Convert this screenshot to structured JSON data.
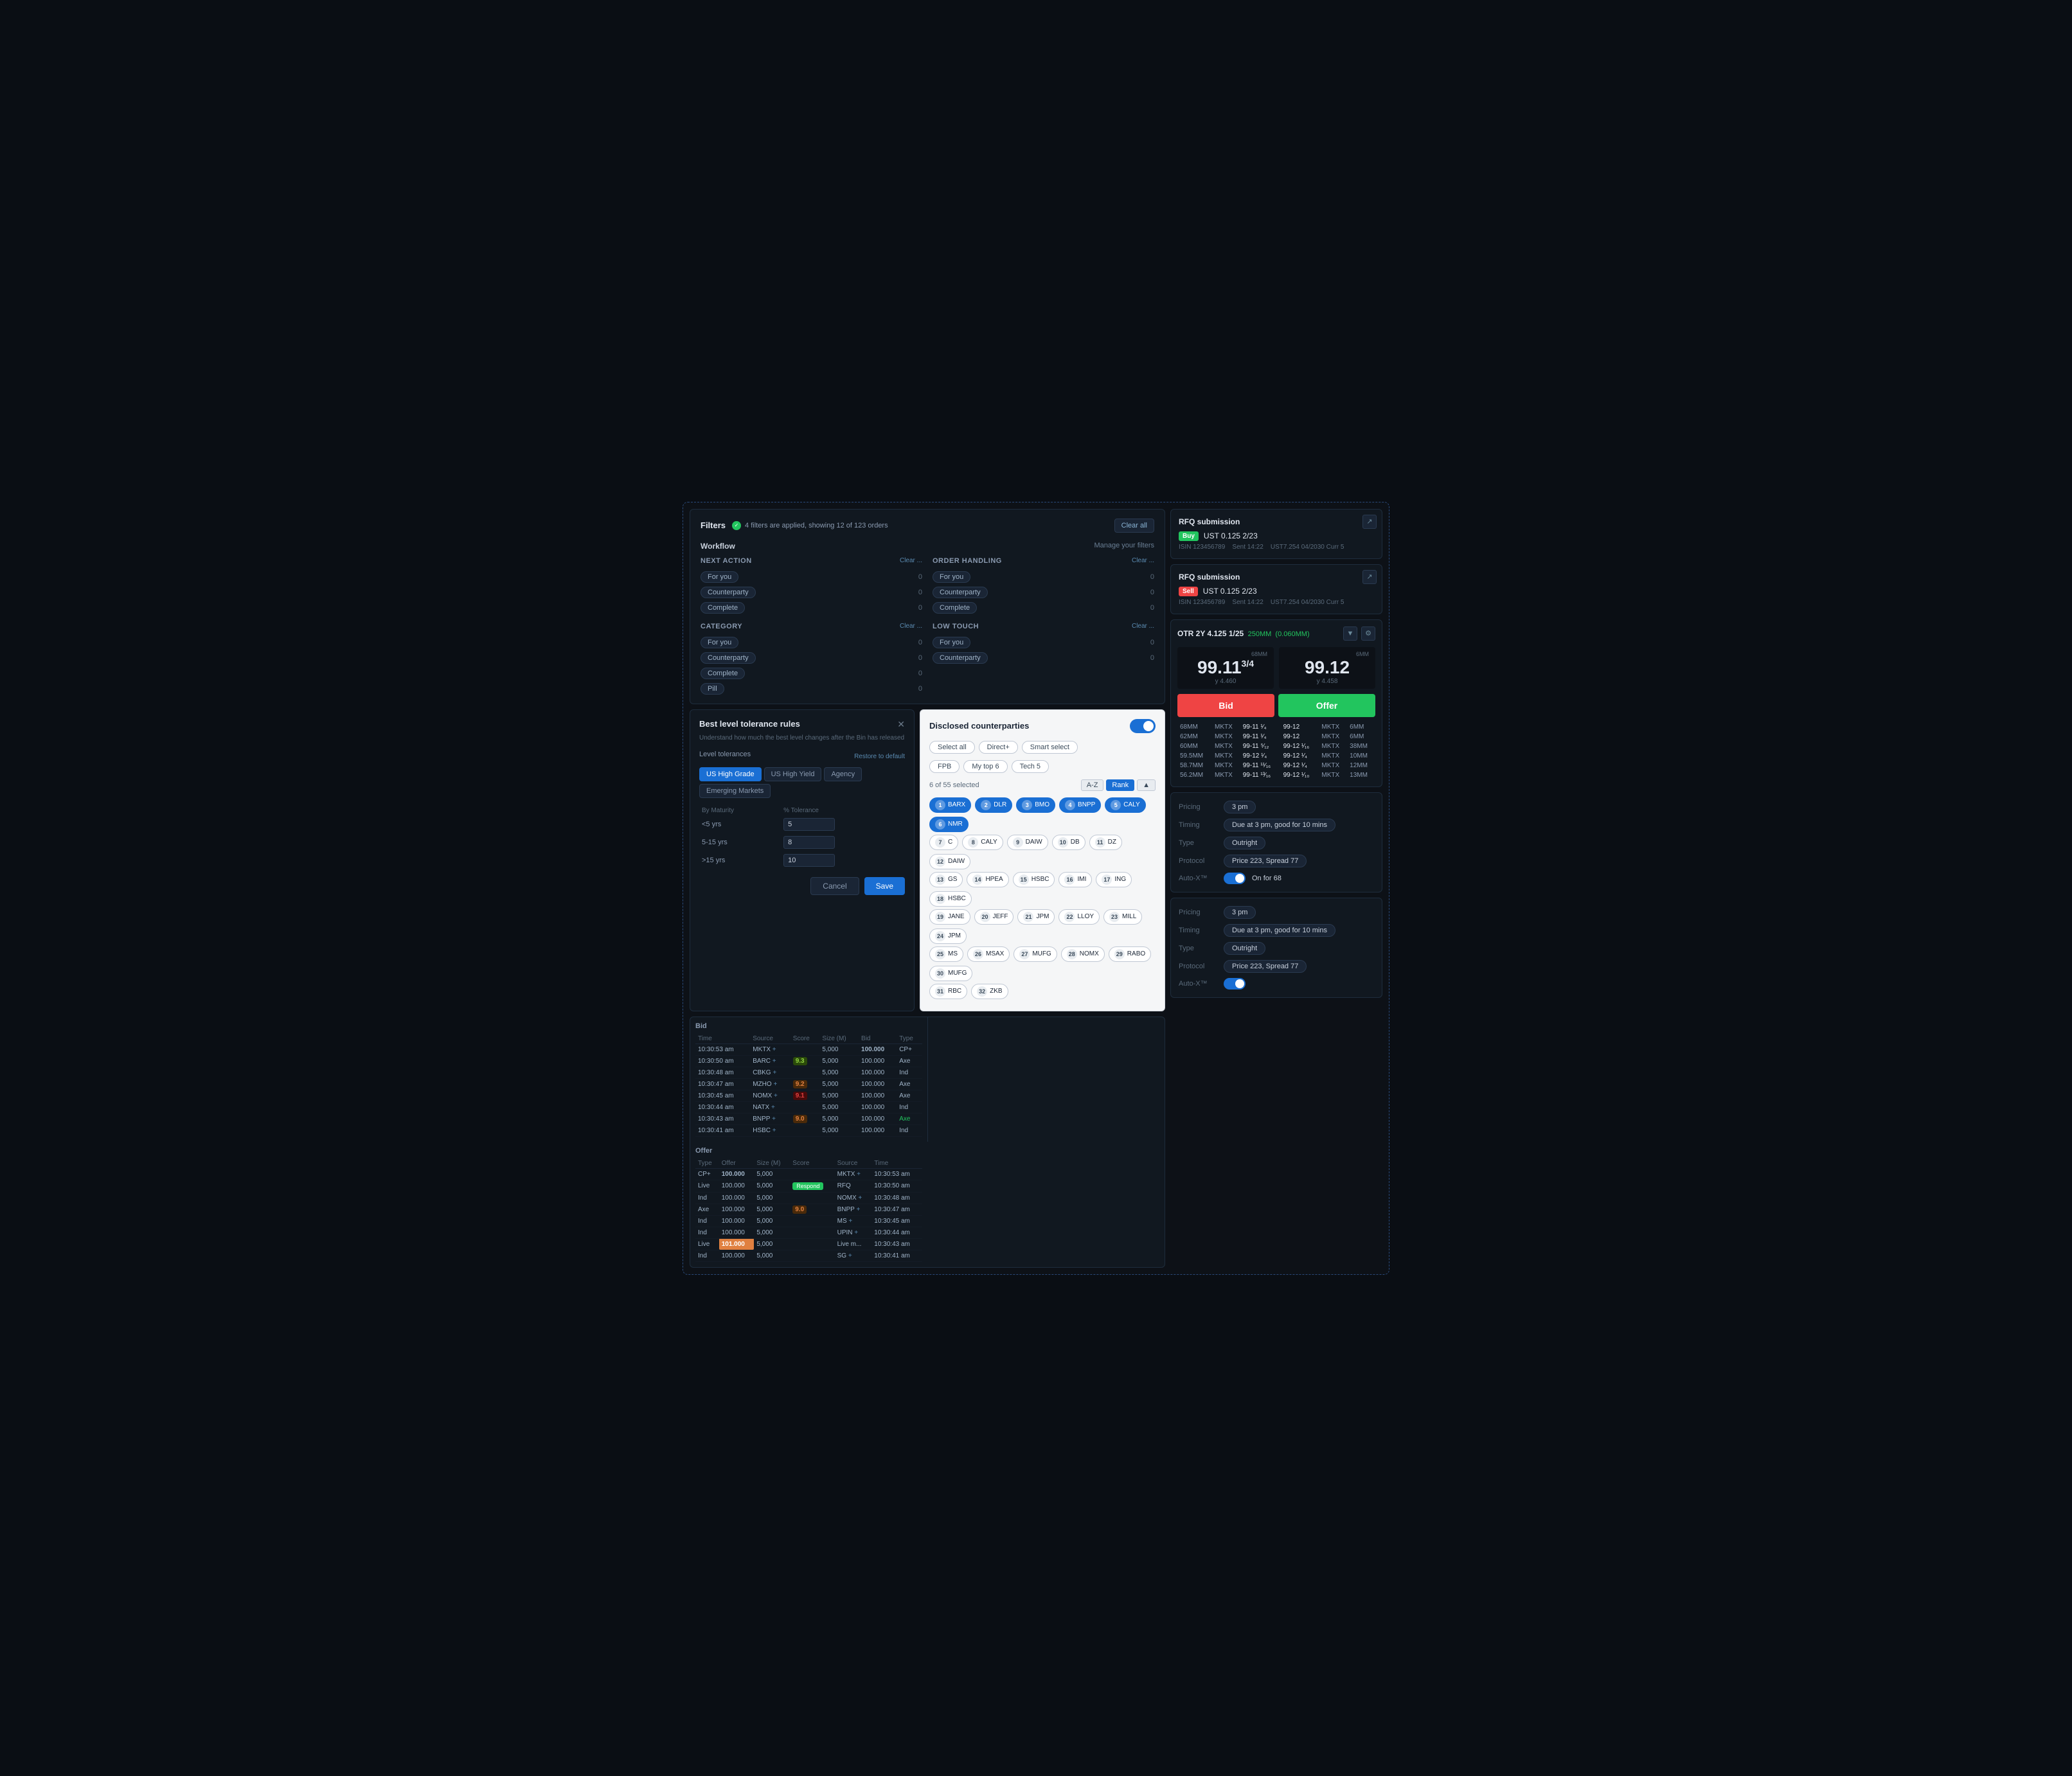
{
  "filters": {
    "title": "Filters",
    "status_text": "4 filters are applied, showing 12 of 123 orders",
    "clear_all": "Clear all",
    "manage_filters": "Manage your filters",
    "workflow_label": "Workflow",
    "groups": [
      {
        "title": "Next action",
        "items": [
          {
            "label": "For you",
            "count": "0"
          },
          {
            "label": "Counterparty",
            "count": "0"
          },
          {
            "label": "Complete",
            "count": "0"
          }
        ]
      },
      {
        "title": "Order handling",
        "items": [
          {
            "label": "For you",
            "count": "0"
          },
          {
            "label": "Counterparty",
            "count": "0"
          },
          {
            "label": "Complete",
            "count": "0"
          }
        ]
      },
      {
        "title": "Category",
        "items": [
          {
            "label": "For you",
            "count": "0"
          },
          {
            "label": "Counterparty",
            "count": "0"
          },
          {
            "label": "Complete",
            "count": "0"
          },
          {
            "label": "Pill",
            "count": "0"
          }
        ]
      },
      {
        "title": "Low touch",
        "items": [
          {
            "label": "For you",
            "count": "0"
          },
          {
            "label": "Counterparty",
            "count": "0"
          }
        ]
      }
    ]
  },
  "tolerance": {
    "title": "Best level tolerance rules",
    "desc": "Understand how much the best level changes after the Bin has released",
    "section": "Level tolerances",
    "restore": "Restore to default",
    "tabs": [
      "US High Grade",
      "US High Yield",
      "Agency",
      "Emerging Markets"
    ],
    "active_tab": "US High Grade",
    "col1": "By Maturity",
    "col2": "% Tolerance",
    "rows": [
      {
        "maturity": "<5 yrs",
        "value": "5"
      },
      {
        "maturity": "5-15 yrs",
        "value": "8"
      },
      {
        "maturity": ">15 yrs",
        "value": "10"
      }
    ],
    "cancel": "Cancel",
    "save": "Save"
  },
  "counterparties": {
    "title": "Disclosed counterparties",
    "count_text": "6 of 55 selected",
    "filter_btns": [
      "Select all",
      "Direct+",
      "Smart select"
    ],
    "filter_tags": [
      "FPB",
      "My top 6",
      "Tech 5"
    ],
    "sort_btns": [
      "A-Z",
      "Rank"
    ],
    "active_sort": "Rank",
    "selected_chips": [
      {
        "num": "1",
        "name": "BARX",
        "selected": true
      },
      {
        "num": "2",
        "name": "DLR",
        "selected": true
      },
      {
        "num": "3",
        "name": "BMO",
        "selected": true
      },
      {
        "num": "4",
        "name": "BNPP",
        "selected": true
      },
      {
        "num": "5",
        "name": "CALY",
        "selected": true
      },
      {
        "num": "6",
        "name": "NMR",
        "selected": true
      }
    ],
    "other_chips": [
      {
        "num": "7",
        "name": "C"
      },
      {
        "num": "8",
        "name": "CALY"
      },
      {
        "num": "9",
        "name": "DAIW"
      },
      {
        "num": "10",
        "name": "DB"
      },
      {
        "num": "11",
        "name": "DZ"
      },
      {
        "num": "12",
        "name": "DAIW"
      },
      {
        "num": "13",
        "name": "GS"
      },
      {
        "num": "14",
        "name": "HPEA"
      },
      {
        "num": "15",
        "name": "HSBC"
      },
      {
        "num": "16",
        "name": "IMI"
      },
      {
        "num": "17",
        "name": "ING"
      },
      {
        "num": "18",
        "name": "HSBC"
      },
      {
        "num": "19",
        "name": "JANE"
      },
      {
        "num": "20",
        "name": "JEFF"
      },
      {
        "num": "21",
        "name": "JPM"
      },
      {
        "num": "22",
        "name": "LLOY"
      },
      {
        "num": "23",
        "name": "MILL"
      },
      {
        "num": "24",
        "name": "JPM"
      },
      {
        "num": "25",
        "name": "MS"
      },
      {
        "num": "26",
        "name": "MSAX"
      },
      {
        "num": "27",
        "name": "MUFG"
      },
      {
        "num": "28",
        "name": "NOMX"
      },
      {
        "num": "29",
        "name": "RABO"
      },
      {
        "num": "30",
        "name": "MUFG"
      },
      {
        "num": "31",
        "name": "RBC"
      },
      {
        "num": "32",
        "name": "ZKB"
      }
    ]
  },
  "rfq1": {
    "title": "RFQ submission",
    "side": "Buy",
    "instrument": "UST 0.125 2/23",
    "isin": "ISIN 123456789",
    "sent": "Sent 14:22",
    "details": "UST7.254 04/2030 Curr 5"
  },
  "rfq2": {
    "title": "RFQ submission",
    "side": "Sell",
    "instrument": "UST 0.125 2/23",
    "isin": "ISIN 123456789",
    "sent": "Sent 14:22",
    "details": "UST7.254 04/2030 Curr 5"
  },
  "otr": {
    "title": "OTR 2Y 4.125 1/25",
    "size": "250MM",
    "spread": "(0.060MM)",
    "bid_size_label": "68MM",
    "offer_size_label": "6MM",
    "bid_price": "99.11",
    "bid_frac": "3/4",
    "bid_yield": "y 4.460",
    "offer_price": "99.12",
    "offer_yield": "y 4.458",
    "bid_btn": "Bid",
    "offer_btn": "Offer",
    "depth_rows": [
      {
        "size1": "68MM",
        "src1": "MKTX",
        "p1": "99-11 1/4",
        "p2": "99-12",
        "src2": "MKTX",
        "size2": "6MM"
      },
      {
        "size1": "62MM",
        "src1": "MKTX",
        "p1": "99-11 1/4",
        "p2": "99-12",
        "src2": "MKTX",
        "size2": "6MM"
      },
      {
        "size1": "60MM",
        "src1": "MKTX",
        "p1": "99-11 5/12",
        "p2": "99-12 1/16",
        "src2": "MKTX",
        "size2": "38MM"
      },
      {
        "size1": "59.5MM",
        "src1": "MKTX",
        "p1": "99-12 1/4",
        "p2": "99-12 1/4",
        "src2": "MKTX",
        "size2": "10MM"
      },
      {
        "size1": "58.7MM",
        "src1": "MKTX",
        "p1": "99-11 11/16",
        "p2": "99-12 1/4",
        "src2": "MKTX",
        "size2": "12MM"
      },
      {
        "size1": "56.2MM",
        "src1": "MKTX",
        "p1": "99-11 13/16",
        "p2": "99-12 1/10",
        "src2": "MKTX",
        "size2": "13MM"
      }
    ]
  },
  "blotter": {
    "bid_label": "Bid",
    "offer_label": "Offer",
    "bid_cols": [
      "Time",
      "Source",
      "Score",
      "Size (M)",
      "Bid",
      "Type"
    ],
    "offer_cols": [
      "Type",
      "Offer",
      "Size (M)",
      "Score",
      "Source",
      "Time"
    ],
    "bid_rows": [
      {
        "time": "10:30:53 am",
        "source": "MKTX +",
        "score": "",
        "size": "5,000",
        "bid": "100.000",
        "type": "CP+",
        "highlight": true
      },
      {
        "time": "10:30:50 am",
        "source": "BARC +",
        "score": "9.3",
        "score_color": "green",
        "size": "5,000",
        "bid": "100.000",
        "type": "Axe"
      },
      {
        "time": "10:30:48 am",
        "source": "CBKG +",
        "score": "",
        "size": "5,000",
        "bid": "100.000",
        "type": "Ind"
      },
      {
        "time": "10:30:47 am",
        "source": "MZHO +",
        "score": "9.2",
        "score_color": "orange",
        "size": "5,000",
        "bid": "100.000",
        "type": "Axe"
      },
      {
        "time": "10:30:45 am",
        "source": "NOMX +",
        "score": "9.1",
        "score_color": "red",
        "size": "5,000",
        "bid": "100.000",
        "type": "Axe"
      },
      {
        "time": "10:30:44 am",
        "source": "NATX +",
        "score": "",
        "size": "5,000",
        "bid": "100.000",
        "type": "Ind"
      },
      {
        "time": "10:30:43 am",
        "source": "BNPP +",
        "score": "9.0",
        "score_color": "orange",
        "size": "5,000",
        "bid": "100.000",
        "type": "Axe",
        "is_live": true
      },
      {
        "time": "10:30:41 am",
        "source": "HSBC +",
        "score": "",
        "size": "5,000",
        "bid": "100.000",
        "type": "Ind"
      }
    ],
    "offer_rows": [
      {
        "type": "CP+",
        "offer": "100.000",
        "size": "5,000",
        "score": "",
        "source": "MKTX +",
        "time": "10:30:53 am",
        "highlight": true
      },
      {
        "type": "Live",
        "offer": "100.000",
        "size": "5,000",
        "score": "",
        "source": "RFQ",
        "time": "10:30:50 am",
        "respond": true
      },
      {
        "type": "Ind",
        "offer": "100.000",
        "size": "5,000",
        "score": "",
        "source": "NOMX +",
        "time": "10:30:48 am"
      },
      {
        "type": "Axe",
        "offer": "100.000",
        "size": "5,000",
        "score": "9.0",
        "score_color": "orange",
        "source": "BNPP +",
        "time": "10:30:47 am"
      },
      {
        "type": "Ind",
        "offer": "100.000",
        "size": "5,000",
        "score": "",
        "source": "MS +",
        "time": "10:30:45 am"
      },
      {
        "type": "Ind",
        "offer": "100.000",
        "size": "5,000",
        "score": "",
        "source": "UPIN +",
        "time": "10:30:44 am"
      },
      {
        "type": "Live",
        "offer": "101.000",
        "size": "5,000",
        "score": "",
        "source": "Live m...",
        "time": "10:30:43 am",
        "offer_high": true
      },
      {
        "type": "Ind",
        "offer": "100.000",
        "size": "5,000",
        "score": "",
        "source": "SG +",
        "time": "10:30:41 am"
      }
    ]
  },
  "pricing1": {
    "pricing": "3 pm",
    "timing": "Due at 3 pm, good for 10 mins",
    "type": "Outright",
    "protocol": "Price 223, Spread 77",
    "auto_x_label": "Auto-X™",
    "auto_x_value": "On for 68"
  },
  "pricing2": {
    "pricing": "3 pm",
    "timing": "Due at 3 pm, good for 10 mins",
    "type": "Outright",
    "protocol": "Price 223, Spread 77",
    "auto_x_label": "Auto-X™"
  }
}
